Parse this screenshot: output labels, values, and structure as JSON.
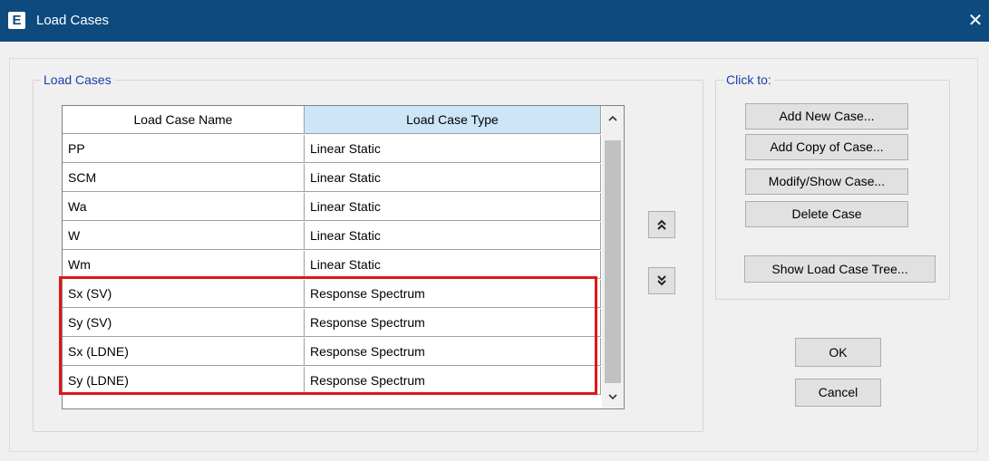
{
  "window": {
    "title": "Load Cases",
    "app_icon_letter": "E",
    "close_glyph": "✕"
  },
  "load_cases_group": {
    "label": "Load Cases",
    "columns": [
      "Load Case Name",
      "Load Case Type"
    ],
    "rows": [
      {
        "name": "PP",
        "type": "Linear Static"
      },
      {
        "name": "SCM",
        "type": "Linear Static"
      },
      {
        "name": "Wa",
        "type": "Linear Static"
      },
      {
        "name": "W",
        "type": "Linear Static"
      },
      {
        "name": "Wm",
        "type": "Linear Static"
      },
      {
        "name": "Sx (SV)",
        "type": "Response Spectrum"
      },
      {
        "name": "Sy (SV)",
        "type": "Response Spectrum"
      },
      {
        "name": "Sx (LDNE)",
        "type": "Response Spectrum"
      },
      {
        "name": "Sy (LDNE)",
        "type": "Response Spectrum"
      }
    ],
    "highlight_color": "#e0161a",
    "move_up_glyph": "⌃",
    "move_down_glyph": "⌄"
  },
  "click_to_group": {
    "label": "Click to:",
    "add_new": "Add New Case...",
    "add_copy": "Add Copy of Case...",
    "modify_show": "Modify/Show Case...",
    "delete": "Delete Case",
    "show_tree": "Show Load Case Tree..."
  },
  "dialog_buttons": {
    "ok": "OK",
    "cancel": "Cancel"
  },
  "colors": {
    "titlebar": "#0e4a7e",
    "group_label": "#1a3fa6",
    "selected_header": "#cde6f7"
  }
}
